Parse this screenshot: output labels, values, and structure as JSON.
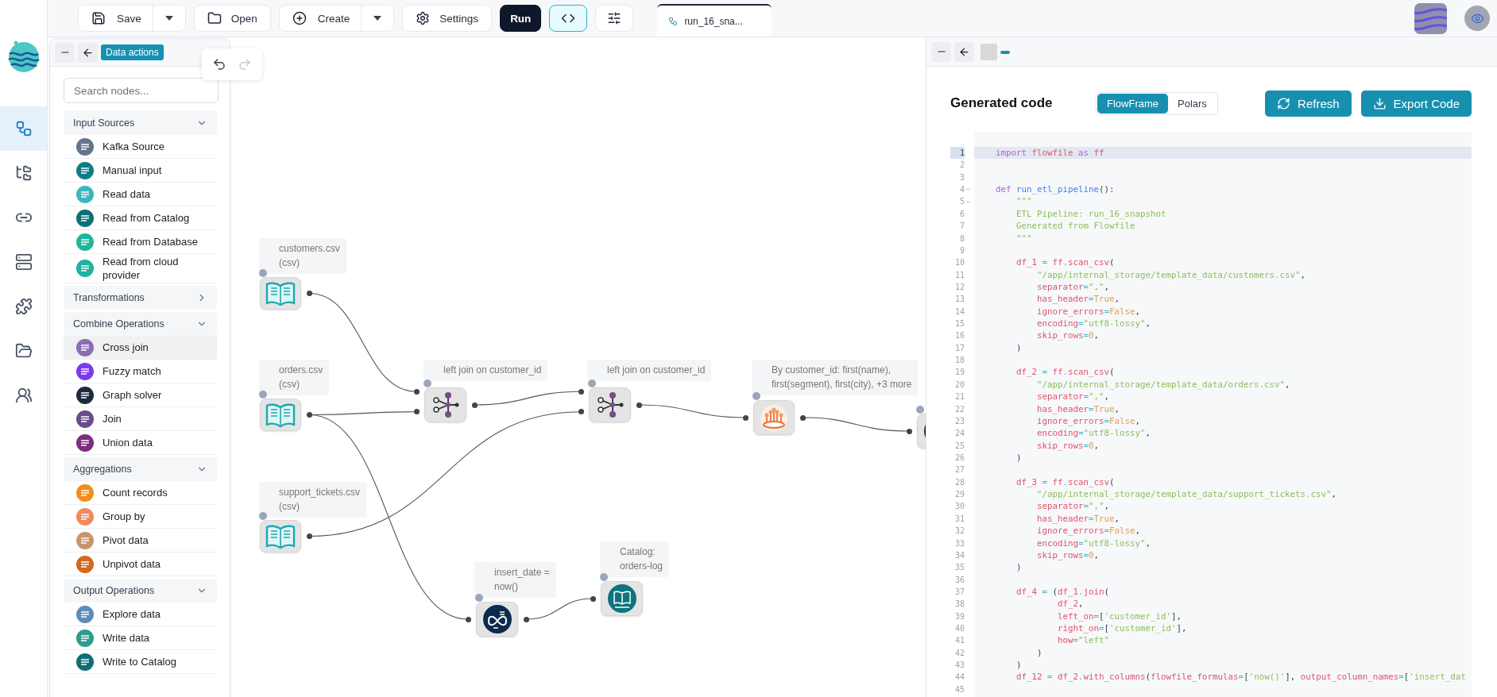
{
  "toolbar": [
    {
      "kind": "split",
      "label": "Save",
      "active": false
    },
    {
      "kind": "plain",
      "label": "Open",
      "active": false
    },
    {
      "kind": "split",
      "label": "Create",
      "active": false
    },
    {
      "kind": "plain",
      "label": "Settings",
      "active": false
    },
    {
      "kind": "primary",
      "label": "Run",
      "active": false
    },
    {
      "kind": "icon",
      "active": true
    },
    {
      "kind": "icon",
      "active": false
    }
  ],
  "tab": {
    "title": "run_16_sna..."
  },
  "nav": [
    {
      "selected": true
    },
    {
      "selected": false
    },
    {
      "selected": false
    },
    {
      "selected": false
    },
    {
      "selected": false
    },
    {
      "selected": false
    },
    {
      "selected": false
    }
  ],
  "history": [
    {
      "disabled": false
    },
    {
      "disabled": true
    }
  ],
  "node_panel": {
    "title": "Data actions",
    "search": {
      "placeholder": "Search nodes..."
    },
    "groups": [
      {
        "title": "Input Sources",
        "expanded": true,
        "items": [
          {
            "label": "Kafka Source",
            "color": "#64748b",
            "selected": false
          },
          {
            "label": "Manual input",
            "color": "#0f7c86",
            "selected": false
          },
          {
            "label": "Read data",
            "color": "#3bb6c0",
            "selected": false
          },
          {
            "label": "Read from Catalog",
            "color": "#0e6f78",
            "selected": false
          },
          {
            "label": "Read from Database",
            "color": "#1fb59a",
            "selected": false
          },
          {
            "label": "Read from cloud provider",
            "color": "#20b2a0",
            "selected": false
          }
        ]
      },
      {
        "title": "Transformations",
        "expanded": false
      },
      {
        "title": "Combine Operations",
        "expanded": true,
        "items": [
          {
            "label": "Cross join",
            "color": "#8a6fb0",
            "selected": true
          },
          {
            "label": "Fuzzy match",
            "color": "#7c3aed",
            "selected": false
          },
          {
            "label": "Graph solver",
            "color": "#1e293b",
            "selected": false
          },
          {
            "label": "Join",
            "color": "#6b4c8a",
            "selected": false
          },
          {
            "label": "Union data",
            "color": "#7b2d7f",
            "selected": false
          }
        ]
      },
      {
        "title": "Aggregations",
        "expanded": true,
        "items": [
          {
            "label": "Count records",
            "color": "#f28c1c",
            "selected": false
          },
          {
            "label": "Group by",
            "color": "#f08a5d",
            "selected": false
          },
          {
            "label": "Pivot data",
            "color": "#c8956a",
            "selected": false
          },
          {
            "label": "Unpivot data",
            "color": "#d2691e",
            "selected": false
          }
        ]
      },
      {
        "title": "Output Operations",
        "expanded": true,
        "items": [
          {
            "label": "Explore data",
            "color": "#5b8db8",
            "selected": false
          },
          {
            "label": "Write data",
            "color": "#2a9d8f",
            "selected": false
          },
          {
            "label": "Write to Catalog",
            "color": "#0e6f78",
            "selected": false
          }
        ]
      }
    ]
  },
  "canvas": {
    "nodes": [
      {
        "kind": "read",
        "label": "customers.csv\n(csv)"
      },
      {
        "kind": "read",
        "label": "orders.csv\n(csv)"
      },
      {
        "kind": "read",
        "label": "support_tickets.csv\n(csv)"
      },
      {
        "kind": "join",
        "label": "left join on customer_id"
      },
      {
        "kind": "join",
        "label": "left join on customer_id"
      },
      {
        "kind": "group_by",
        "label": "By customer_id: first(name),\nfirst(segment), first(city), +3 more"
      },
      {
        "kind": "formula"
      },
      {
        "kind": "formula",
        "label": "insert_date =\nnow()"
      },
      {
        "kind": "catalog_write",
        "label": "Catalog:\norders-log"
      }
    ]
  },
  "code_panel": {
    "title": "Generated code",
    "modes": [
      {
        "label": "FlowFrame",
        "selected": true
      },
      {
        "label": "Polars",
        "selected": false
      }
    ],
    "actions": [
      "Refresh",
      "Export Code"
    ],
    "lines": [
      {
        "number": "1",
        "active": true,
        "foldable": false,
        "tokens": [
          {
            "kind": "keyword",
            "text": "import "
          },
          {
            "kind": "name",
            "text": "flowfile "
          },
          {
            "kind": "keyword",
            "text": "as "
          },
          {
            "kind": "name",
            "text": "ff"
          }
        ]
      },
      {
        "number": "2",
        "active": false,
        "foldable": false
      },
      {
        "number": "3",
        "active": false,
        "foldable": false
      },
      {
        "number": "4",
        "active": false,
        "foldable": true,
        "tokens": [
          {
            "kind": "keyword",
            "text": "def "
          },
          {
            "kind": "function",
            "text": "run_etl_pipeline"
          },
          {
            "kind": "punctuation",
            "text": "():"
          }
        ]
      },
      {
        "number": "5",
        "active": false,
        "foldable": true,
        "tokens": [
          {
            "kind": "string",
            "text": "    \"\"\""
          }
        ]
      },
      {
        "number": "6",
        "active": false,
        "foldable": false,
        "tokens": [
          {
            "kind": "string",
            "text": "    ETL Pipeline: run_16_snapshot"
          }
        ]
      },
      {
        "number": "7",
        "active": false,
        "foldable": false,
        "tokens": [
          {
            "kind": "string",
            "text": "    Generated from Flowfile"
          }
        ]
      },
      {
        "number": "8",
        "active": false,
        "foldable": false,
        "tokens": [
          {
            "kind": "string",
            "text": "    \"\"\""
          }
        ]
      },
      {
        "number": "9",
        "active": false,
        "foldable": false
      },
      {
        "number": "10",
        "active": false,
        "foldable": false,
        "tokens": [
          {
            "kind": "name",
            "text": "    df_1"
          },
          {
            "kind": "operator",
            "text": " = "
          },
          {
            "kind": "name",
            "text": "ff"
          },
          {
            "kind": "operator",
            "text": "."
          },
          {
            "kind": "name",
            "text": "scan_csv"
          },
          {
            "kind": "punctuation",
            "text": "("
          }
        ]
      },
      {
        "number": "11",
        "active": false,
        "foldable": false,
        "tokens": [
          {
            "kind": "string",
            "text": "        \"/app/internal_storage/template_data/customers.csv\""
          },
          {
            "kind": "punctuation",
            "text": ","
          }
        ]
      },
      {
        "number": "12",
        "active": false,
        "foldable": false,
        "tokens": [
          {
            "kind": "name",
            "text": "        separator"
          },
          {
            "kind": "operator",
            "text": "="
          },
          {
            "kind": "string",
            "text": "\",\""
          },
          {
            "kind": "punctuation",
            "text": ","
          }
        ]
      },
      {
        "number": "13",
        "active": false,
        "foldable": false,
        "tokens": [
          {
            "kind": "name",
            "text": "        has_header"
          },
          {
            "kind": "operator",
            "text": "="
          },
          {
            "kind": "number",
            "text": "True"
          },
          {
            "kind": "punctuation",
            "text": ","
          }
        ]
      },
      {
        "number": "14",
        "active": false,
        "foldable": false,
        "tokens": [
          {
            "kind": "name",
            "text": "        ignore_errors"
          },
          {
            "kind": "operator",
            "text": "="
          },
          {
            "kind": "number",
            "text": "False"
          },
          {
            "kind": "punctuation",
            "text": ","
          }
        ]
      },
      {
        "number": "15",
        "active": false,
        "foldable": false,
        "tokens": [
          {
            "kind": "name",
            "text": "        encoding"
          },
          {
            "kind": "operator",
            "text": "="
          },
          {
            "kind": "string",
            "text": "\"utf8-lossy\""
          },
          {
            "kind": "punctuation",
            "text": ","
          }
        ]
      },
      {
        "number": "16",
        "active": false,
        "foldable": false,
        "tokens": [
          {
            "kind": "name",
            "text": "        skip_rows"
          },
          {
            "kind": "operator",
            "text": "="
          },
          {
            "kind": "number",
            "text": "0"
          },
          {
            "kind": "punctuation",
            "text": ","
          }
        ]
      },
      {
        "number": "17",
        "active": false,
        "foldable": false,
        "tokens": [
          {
            "kind": "punctuation",
            "text": "    )"
          }
        ]
      },
      {
        "number": "18",
        "active": false,
        "foldable": false
      },
      {
        "number": "19",
        "active": false,
        "foldable": false,
        "tokens": [
          {
            "kind": "name",
            "text": "    df_2"
          },
          {
            "kind": "operator",
            "text": " = "
          },
          {
            "kind": "name",
            "text": "ff"
          },
          {
            "kind": "operator",
            "text": "."
          },
          {
            "kind": "name",
            "text": "scan_csv"
          },
          {
            "kind": "punctuation",
            "text": "("
          }
        ]
      },
      {
        "number": "20",
        "active": false,
        "foldable": false,
        "tokens": [
          {
            "kind": "string",
            "text": "        \"/app/internal_storage/template_data/orders.csv\""
          },
          {
            "kind": "punctuation",
            "text": ","
          }
        ]
      },
      {
        "number": "21",
        "active": false,
        "foldable": false,
        "tokens": [
          {
            "kind": "name",
            "text": "        separator"
          },
          {
            "kind": "operator",
            "text": "="
          },
          {
            "kind": "string",
            "text": "\",\""
          },
          {
            "kind": "punctuation",
            "text": ","
          }
        ]
      },
      {
        "number": "22",
        "active": false,
        "foldable": false,
        "tokens": [
          {
            "kind": "name",
            "text": "        has_header"
          },
          {
            "kind": "operator",
            "text": "="
          },
          {
            "kind": "number",
            "text": "True"
          },
          {
            "kind": "punctuation",
            "text": ","
          }
        ]
      },
      {
        "number": "23",
        "active": false,
        "foldable": false,
        "tokens": [
          {
            "kind": "name",
            "text": "        ignore_errors"
          },
          {
            "kind": "operator",
            "text": "="
          },
          {
            "kind": "number",
            "text": "False"
          },
          {
            "kind": "punctuation",
            "text": ","
          }
        ]
      },
      {
        "number": "24",
        "active": false,
        "foldable": false,
        "tokens": [
          {
            "kind": "name",
            "text": "        encoding"
          },
          {
            "kind": "operator",
            "text": "="
          },
          {
            "kind": "string",
            "text": "\"utf8-lossy\""
          },
          {
            "kind": "punctuation",
            "text": ","
          }
        ]
      },
      {
        "number": "25",
        "active": false,
        "foldable": false,
        "tokens": [
          {
            "kind": "name",
            "text": "        skip_rows"
          },
          {
            "kind": "operator",
            "text": "="
          },
          {
            "kind": "number",
            "text": "0"
          },
          {
            "kind": "punctuation",
            "text": ","
          }
        ]
      },
      {
        "number": "26",
        "active": false,
        "foldable": false,
        "tokens": [
          {
            "kind": "punctuation",
            "text": "    )"
          }
        ]
      },
      {
        "number": "27",
        "active": false,
        "foldable": false
      },
      {
        "number": "28",
        "active": false,
        "foldable": false,
        "tokens": [
          {
            "kind": "name",
            "text": "    df_3"
          },
          {
            "kind": "operator",
            "text": " = "
          },
          {
            "kind": "name",
            "text": "ff"
          },
          {
            "kind": "operator",
            "text": "."
          },
          {
            "kind": "name",
            "text": "scan_csv"
          },
          {
            "kind": "punctuation",
            "text": "("
          }
        ]
      },
      {
        "number": "29",
        "active": false,
        "foldable": false,
        "tokens": [
          {
            "kind": "string",
            "text": "        \"/app/internal_storage/template_data/support_tickets.csv\""
          },
          {
            "kind": "punctuation",
            "text": ","
          }
        ]
      },
      {
        "number": "30",
        "active": false,
        "foldable": false,
        "tokens": [
          {
            "kind": "name",
            "text": "        separator"
          },
          {
            "kind": "operator",
            "text": "="
          },
          {
            "kind": "string",
            "text": "\",\""
          },
          {
            "kind": "punctuation",
            "text": ","
          }
        ]
      },
      {
        "number": "31",
        "active": false,
        "foldable": false,
        "tokens": [
          {
            "kind": "name",
            "text": "        has_header"
          },
          {
            "kind": "operator",
            "text": "="
          },
          {
            "kind": "number",
            "text": "True"
          },
          {
            "kind": "punctuation",
            "text": ","
          }
        ]
      },
      {
        "number": "32",
        "active": false,
        "foldable": false,
        "tokens": [
          {
            "kind": "name",
            "text": "        ignore_errors"
          },
          {
            "kind": "operator",
            "text": "="
          },
          {
            "kind": "number",
            "text": "False"
          },
          {
            "kind": "punctuation",
            "text": ","
          }
        ]
      },
      {
        "number": "33",
        "active": false,
        "foldable": false,
        "tokens": [
          {
            "kind": "name",
            "text": "        encoding"
          },
          {
            "kind": "operator",
            "text": "="
          },
          {
            "kind": "string",
            "text": "\"utf8-lossy\""
          },
          {
            "kind": "punctuation",
            "text": ","
          }
        ]
      },
      {
        "number": "34",
        "active": false,
        "foldable": false,
        "tokens": [
          {
            "kind": "name",
            "text": "        skip_rows"
          },
          {
            "kind": "operator",
            "text": "="
          },
          {
            "kind": "number",
            "text": "0"
          },
          {
            "kind": "punctuation",
            "text": ","
          }
        ]
      },
      {
        "number": "35",
        "active": false,
        "foldable": false,
        "tokens": [
          {
            "kind": "punctuation",
            "text": "    )"
          }
        ]
      },
      {
        "number": "36",
        "active": false,
        "foldable": false
      },
      {
        "number": "37",
        "active": false,
        "foldable": false,
        "tokens": [
          {
            "kind": "name",
            "text": "    df_4"
          },
          {
            "kind": "operator",
            "text": " = "
          },
          {
            "kind": "punctuation",
            "text": "("
          },
          {
            "kind": "name",
            "text": "df_1"
          },
          {
            "kind": "operator",
            "text": "."
          },
          {
            "kind": "name",
            "text": "join"
          },
          {
            "kind": "punctuation",
            "text": "("
          }
        ]
      },
      {
        "number": "38",
        "active": false,
        "foldable": false,
        "tokens": [
          {
            "kind": "name",
            "text": "            df_2"
          },
          {
            "kind": "punctuation",
            "text": ","
          }
        ]
      },
      {
        "number": "39",
        "active": false,
        "foldable": false,
        "tokens": [
          {
            "kind": "name",
            "text": "            left_on"
          },
          {
            "kind": "operator",
            "text": "="
          },
          {
            "kind": "punctuation",
            "text": "["
          },
          {
            "kind": "string",
            "text": "'customer_id'"
          },
          {
            "kind": "punctuation",
            "text": "],"
          }
        ]
      },
      {
        "number": "40",
        "active": false,
        "foldable": false,
        "tokens": [
          {
            "kind": "name",
            "text": "            right_on"
          },
          {
            "kind": "operator",
            "text": "="
          },
          {
            "kind": "punctuation",
            "text": "["
          },
          {
            "kind": "string",
            "text": "'customer_id'"
          },
          {
            "kind": "punctuation",
            "text": "],"
          }
        ]
      },
      {
        "number": "41",
        "active": false,
        "foldable": false,
        "tokens": [
          {
            "kind": "name",
            "text": "            how"
          },
          {
            "kind": "operator",
            "text": "="
          },
          {
            "kind": "string",
            "text": "\"left\""
          }
        ]
      },
      {
        "number": "42",
        "active": false,
        "foldable": false,
        "tokens": [
          {
            "kind": "punctuation",
            "text": "        )"
          }
        ]
      },
      {
        "number": "43",
        "active": false,
        "foldable": false,
        "tokens": [
          {
            "kind": "punctuation",
            "text": "    )"
          }
        ]
      },
      {
        "number": "44",
        "active": false,
        "foldable": false,
        "tokens": [
          {
            "kind": "name",
            "text": "    df_12"
          },
          {
            "kind": "operator",
            "text": " = "
          },
          {
            "kind": "name",
            "text": "df_2"
          },
          {
            "kind": "operator",
            "text": "."
          },
          {
            "kind": "name",
            "text": "with_columns"
          },
          {
            "kind": "punctuation",
            "text": "("
          },
          {
            "kind": "name",
            "text": "flowfile_formulas"
          },
          {
            "kind": "operator",
            "text": "="
          },
          {
            "kind": "punctuation",
            "text": "["
          },
          {
            "kind": "string",
            "text": "'now()'"
          },
          {
            "kind": "punctuation",
            "text": "], "
          },
          {
            "kind": "name",
            "text": "output_column_names"
          },
          {
            "kind": "operator",
            "text": "="
          },
          {
            "kind": "punctuation",
            "text": "["
          },
          {
            "kind": "string",
            "text": "'insert_dat"
          }
        ]
      },
      {
        "number": "45",
        "active": false,
        "foldable": false
      }
    ]
  }
}
